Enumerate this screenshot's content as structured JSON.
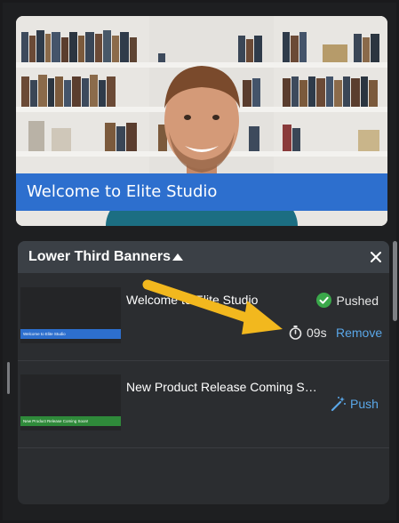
{
  "preview": {
    "banner_text": "Welcome to Elite Studio"
  },
  "panel": {
    "title": "Lower Third Banners",
    "collapse_icon": "caret-up-icon",
    "close_icon": "close-icon"
  },
  "banners": [
    {
      "thumb_text": "Welcome to Elite Studio",
      "thumb_color": "#2d6fce",
      "title": "Welcome to Elite Studio",
      "status": "Pushed",
      "timer": "09s",
      "action": "Remove"
    },
    {
      "thumb_text": "New Product Release Coming Soon!",
      "thumb_color": "#2f8a3a",
      "title": "New Product Release Coming So...",
      "action": "Push"
    }
  ],
  "colors": {
    "accent": "#2d6fce",
    "link": "#5aa7e8",
    "success": "#3aa84a",
    "annotation_arrow": "#f2b81e"
  }
}
